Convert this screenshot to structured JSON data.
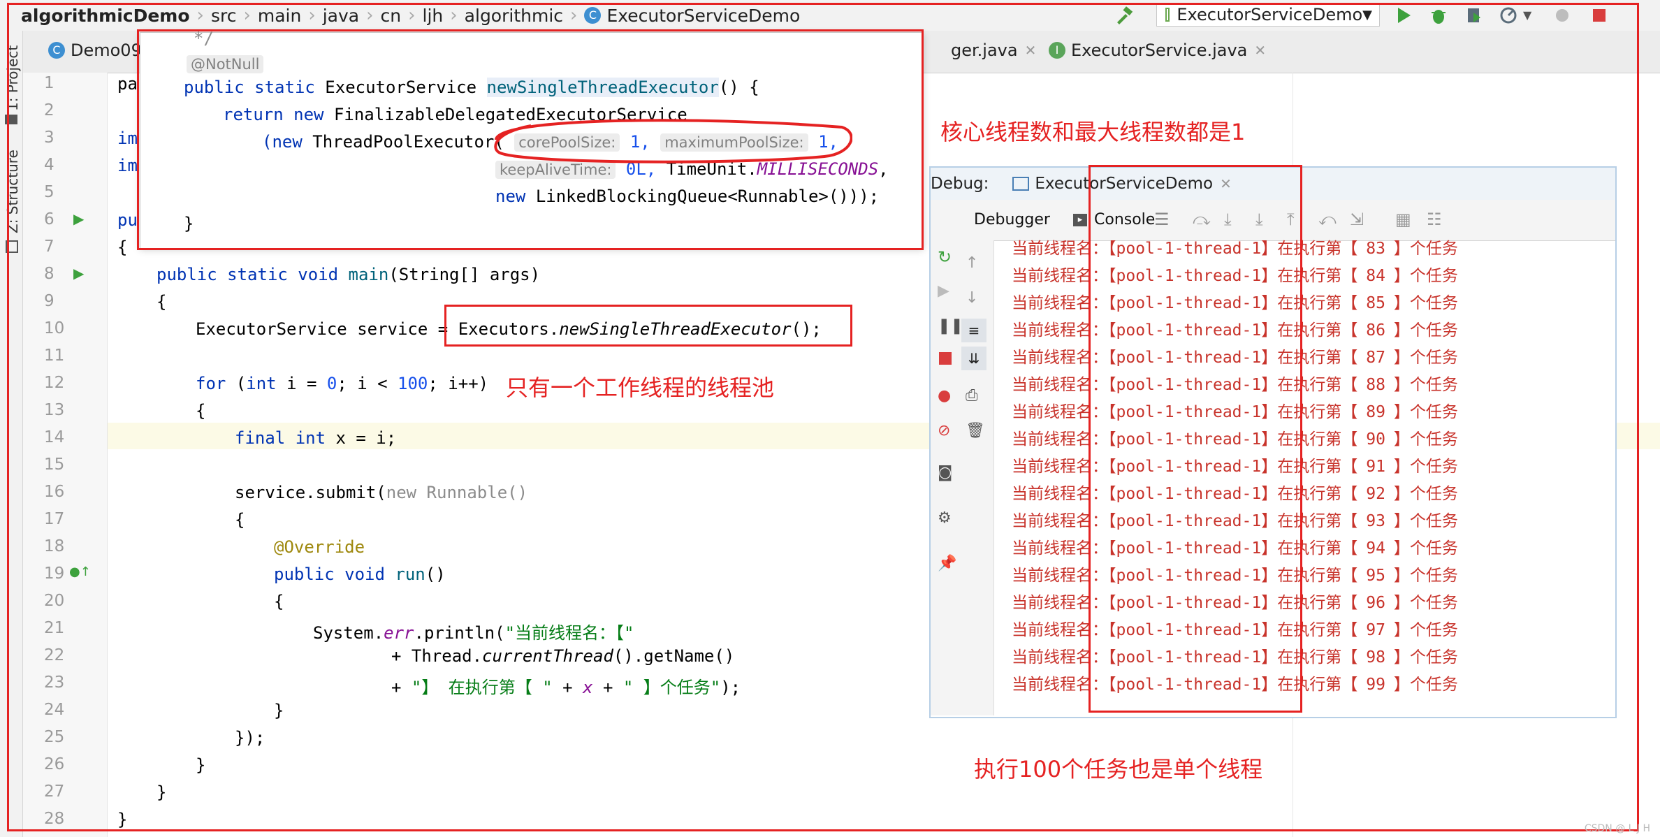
{
  "breadcrumb": [
    "algorithmicDemo",
    "src",
    "main",
    "java",
    "cn",
    "ljh",
    "algorithmic",
    "ExecutorServiceDemo"
  ],
  "run_config": {
    "label": "ExecutorServiceDemo"
  },
  "tool_windows": {
    "project": "1: Project",
    "structure": "Z: Structure"
  },
  "tabs": [
    {
      "label": "Demo09."
    },
    {
      "label": "ger.java"
    },
    {
      "label": "ExecutorService.java"
    }
  ],
  "line_numbers": [
    "1",
    "2",
    "3",
    "4",
    "5",
    "6",
    "7",
    "8",
    "9",
    "10",
    "11",
    "12",
    "13",
    "14",
    "15",
    "16",
    "17",
    "18",
    "19",
    "20",
    "21",
    "22",
    "23",
    "24",
    "25",
    "26",
    "27",
    "28"
  ],
  "code_fragments": {
    "l1": "pa",
    "l3": "im",
    "l4": "im",
    "l6": "pu",
    "l7": "{"
  },
  "popup": {
    "comment_end": "*/",
    "annotation": "@NotNull",
    "sig_kw": "public static",
    "sig_type": "ExecutorService",
    "sig_method": "newSingleThreadExecutor",
    "sig_end": "() {",
    "ret_kw": "return new",
    "ret_class": "FinalizableDelegatedExecutorService",
    "new_kw": "(new",
    "tpe": "ThreadPoolExecutor(",
    "hint_core": "corePoolSize:",
    "val_core": "1,",
    "hint_max": "maximumPoolSize:",
    "val_max": "1,",
    "hint_keep": "keepAliveTime:",
    "val_keep": "0L,",
    "time_unit": "TimeUnit.",
    "millis": "MILLISECONDS",
    "comma": ",",
    "new2": "new",
    "queue": "LinkedBlockingQueue<Runnable>()));",
    "close": "}"
  },
  "main_code": {
    "l8_kw": "public static void",
    "l8_fn": "main",
    "l8_rest": "(String[] args)",
    "l9": "{",
    "l10_a": "ExecutorService service = ",
    "l10_b": "Executors.",
    "l10_c": "newSingleThreadExecutor",
    "l10_d": "();",
    "l12_kw": "for",
    "l12_a": " (",
    "l12_int": "int",
    "l12_b": " i = ",
    "l12_0": "0",
    "l12_c": "; i < ",
    "l12_100": "100",
    "l12_d": "; i++)",
    "l13": "{",
    "l14_kw": "final int",
    "l14_rest": " x = i;",
    "l16_a": "service.submit(",
    "l16_b": "new Runnable()",
    "l17": "{",
    "l18": "@Override",
    "l19_kw": "public void",
    "l19_fn": "run",
    "l19_rest": "()",
    "l20": "{",
    "l21_a": "System.",
    "l21_err": "err",
    "l21_b": ".println(",
    "l21_str": "\"当前线程名：【\"",
    "l22_a": "+ Thread.",
    "l22_b": "currentThread",
    "l22_c": "().getName()",
    "l23_a": "+ ",
    "l23_str1": "\"】 在执行第【 \"",
    "l23_b": " + ",
    "l23_x": "x",
    "l23_c": " + ",
    "l23_str2": "\" 】个任务\"",
    "l23_d": ");",
    "l24": "}",
    "l25": "});",
    "l26": "}",
    "l27": "}",
    "l28": "}"
  },
  "debug": {
    "label": "Debug:",
    "config": "ExecutorServiceDemo",
    "tab_debugger": "Debugger",
    "tab_console": "Console",
    "prefix": "当前线程名：",
    "thread": "【pool-1-thread-1】",
    "mid": "在执行第【",
    "suffix": "】个任务",
    "tasks": [
      "83",
      "84",
      "85",
      "86",
      "87",
      "88",
      "89",
      "90",
      "91",
      "92",
      "93",
      "94",
      "95",
      "96",
      "97",
      "98",
      "99"
    ]
  },
  "annotations": {
    "core_max": "核心线程数和最大线程数都是1",
    "single_worker": "只有一个工作线程的线程池",
    "hundred_tasks": "执行100个任务也是单个线程"
  },
  "watermark": "CSDN @ L J H",
  "colors": {
    "annotation_red": "#e52222",
    "keyword_blue": "#0033b3",
    "console_red": "#c8332b"
  }
}
